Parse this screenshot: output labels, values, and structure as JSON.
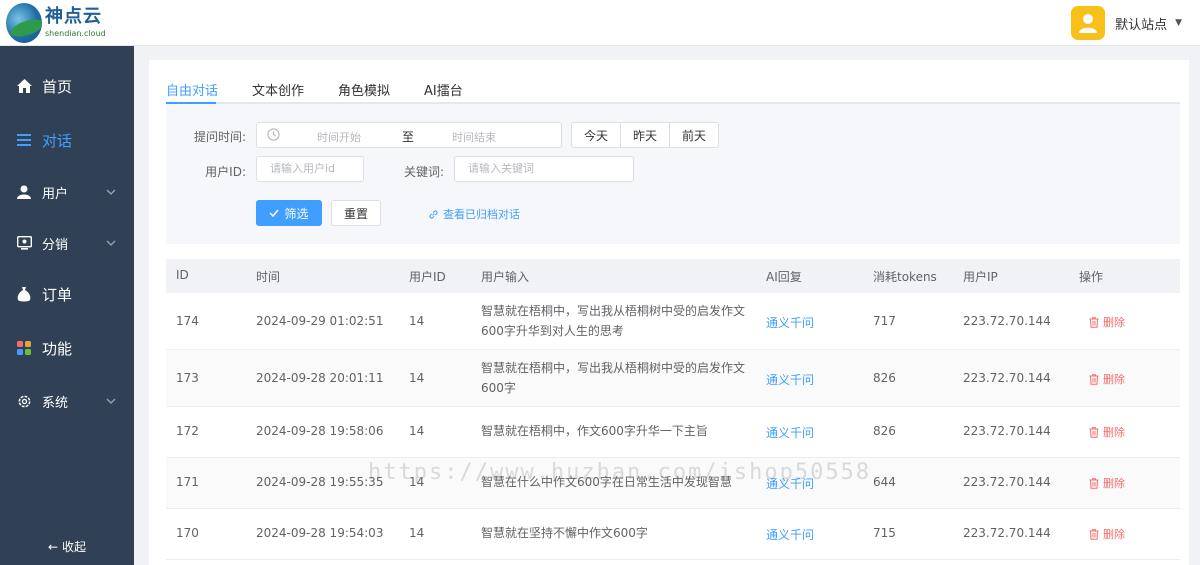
{
  "brand": {
    "name_cn": "神点云",
    "name_en": "shendian.cloud"
  },
  "header": {
    "user_name": "默认站点"
  },
  "sidebar": {
    "items": [
      {
        "label": "首页",
        "icon": "home-icon"
      },
      {
        "label": "对话",
        "icon": "list-icon",
        "active": true
      },
      {
        "label": "用户",
        "icon": "user-icon"
      },
      {
        "label": "分销",
        "icon": "distribution-icon"
      },
      {
        "label": "订单",
        "icon": "money-bag-icon"
      },
      {
        "label": "功能",
        "icon": "apps-icon"
      },
      {
        "label": "系统",
        "icon": "gear-icon"
      }
    ],
    "collapse_label": "收起"
  },
  "tabs": [
    {
      "label": "自由对话",
      "active": true
    },
    {
      "label": "文本创作"
    },
    {
      "label": "角色模拟"
    },
    {
      "label": "AI擂台"
    }
  ],
  "filter": {
    "time_label": "提问时间:",
    "time_start_placeholder": "时间开始",
    "time_sep": "至",
    "time_end_placeholder": "时间结束",
    "quick_buttons": [
      "今天",
      "昨天",
      "前天"
    ],
    "user_id_label": "用户ID:",
    "user_id_placeholder": "请输入用户id",
    "keyword_label": "关键词:",
    "keyword_placeholder": "请输入关键词",
    "filter_button": "筛选",
    "reset_button": "重置",
    "archive_link": "查看已归档对话"
  },
  "table": {
    "headers": [
      "ID",
      "时间",
      "用户ID",
      "用户输入",
      "AI回复",
      "消耗tokens",
      "用户IP",
      "操作"
    ],
    "rows": [
      {
        "id": "174",
        "time": "2024-09-29 01:02:51",
        "user_id": "14",
        "input": "智慧就在梧桐中，写出我从梧桐树中受的启发作文600字升华到对人生的思考",
        "reply": "通义千问",
        "tokens": "717",
        "ip": "223.72.70.144",
        "action": "删除"
      },
      {
        "id": "173",
        "time": "2024-09-28 20:01:11",
        "user_id": "14",
        "input": "智慧就在梧桐中，写出我从梧桐树中受的启发作文600字",
        "reply": "通义千问",
        "tokens": "826",
        "ip": "223.72.70.144",
        "action": "删除"
      },
      {
        "id": "172",
        "time": "2024-09-28 19:58:06",
        "user_id": "14",
        "input": "智慧就在梧桐中，作文600字升华一下主旨",
        "reply": "通义千问",
        "tokens": "826",
        "ip": "223.72.70.144",
        "action": "删除"
      },
      {
        "id": "171",
        "time": "2024-09-28 19:55:35",
        "user_id": "14",
        "input": "智慧在什么中作文600字在日常生活中发现智慧",
        "reply": "通义千问",
        "tokens": "644",
        "ip": "223.72.70.144",
        "action": "删除"
      },
      {
        "id": "170",
        "time": "2024-09-28 19:54:03",
        "user_id": "14",
        "input": "智慧就在坚持不懈中作文600字",
        "reply": "通义千问",
        "tokens": "715",
        "ip": "223.72.70.144",
        "action": "删除"
      }
    ]
  },
  "watermark": "https://www.huzhan.com/ishop50558",
  "colors": {
    "sidebar_bg": "#304156",
    "accent": "#409eff",
    "danger": "#f56c6c",
    "avatar_bg": "#f7c11a"
  }
}
